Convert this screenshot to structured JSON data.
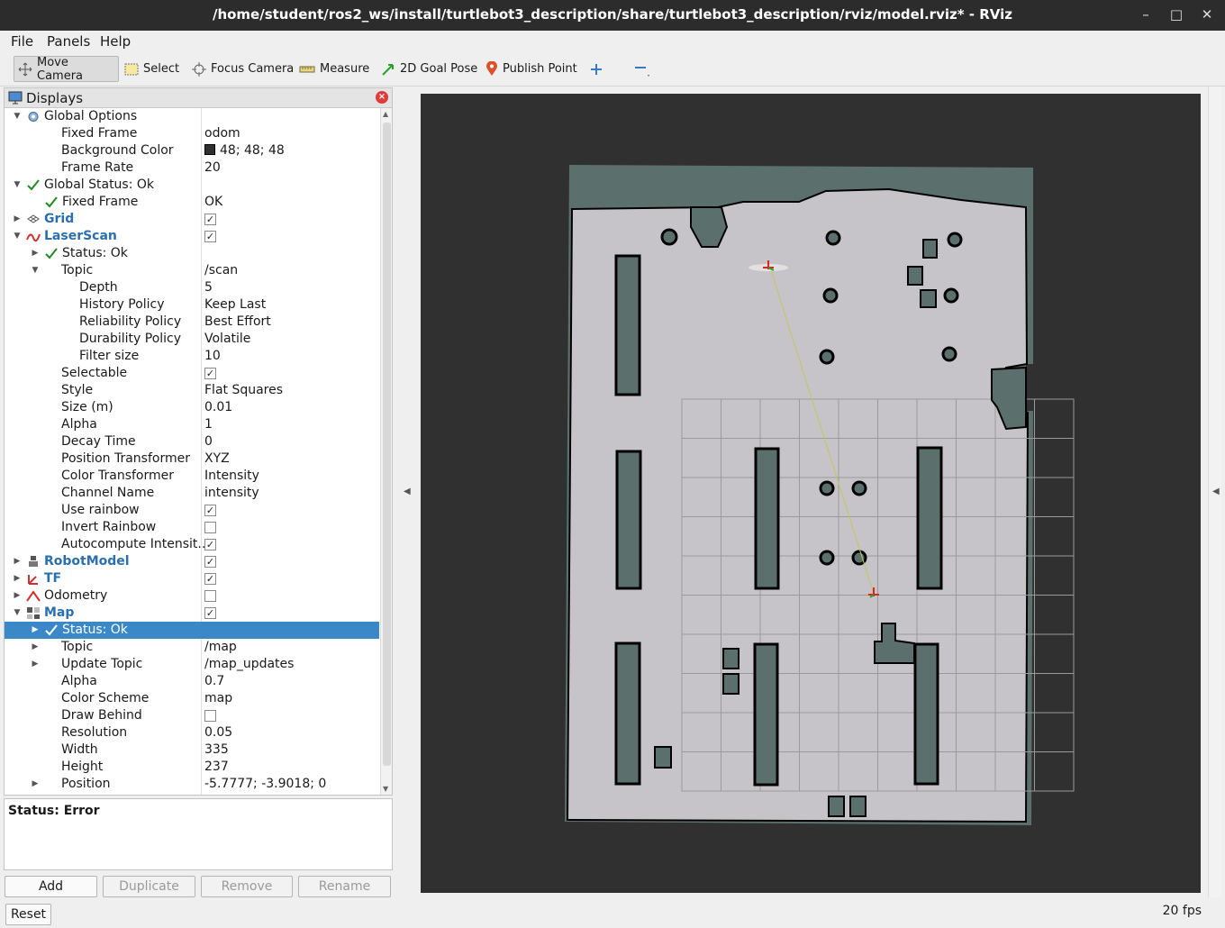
{
  "window": {
    "title": "/home/student/ros2_ws/install/turtlebot3_description/share/turtlebot3_description/rviz/model.rviz* - RViz"
  },
  "menu": [
    "File",
    "Panels",
    "Help"
  ],
  "toolbar": {
    "tools": [
      "Move Camera",
      "Select",
      "Focus Camera",
      "Measure",
      "2D Goal Pose",
      "Publish Point"
    ],
    "active": "Move Camera"
  },
  "displays": {
    "title": "Displays",
    "rows": [
      {
        "name": "Global Options",
        "value": "",
        "indent": 0,
        "expand": "open",
        "icon": "gear-icon"
      },
      {
        "name": "Fixed Frame",
        "value": "odom",
        "indent": 1
      },
      {
        "name": "Background Color",
        "value": "48; 48; 48",
        "indent": 1,
        "swatch": "#303030"
      },
      {
        "name": "Frame Rate",
        "value": "20",
        "indent": 1
      },
      {
        "name": "Global Status: Ok",
        "value": "",
        "indent": 0,
        "expand": "open",
        "icon": "check-icon"
      },
      {
        "name": "Fixed Frame",
        "value": "OK",
        "indent": 1,
        "icon": "check-icon"
      },
      {
        "name": "Grid",
        "value": "",
        "indent": 0,
        "expand": "closed",
        "icon": "grid-icon",
        "blue": true,
        "checked": true
      },
      {
        "name": "LaserScan",
        "value": "",
        "indent": 0,
        "expand": "open",
        "icon": "laserscan-icon",
        "blue": true,
        "checked": true
      },
      {
        "name": "Status: Ok",
        "value": "",
        "indent": 1,
        "expand": "closed",
        "icon": "check-icon"
      },
      {
        "name": "Topic",
        "value": "/scan",
        "indent": 1,
        "expand": "open"
      },
      {
        "name": "Depth",
        "value": "5",
        "indent": 2
      },
      {
        "name": "History Policy",
        "value": "Keep Last",
        "indent": 2
      },
      {
        "name": "Reliability Policy",
        "value": "Best Effort",
        "indent": 2
      },
      {
        "name": "Durability Policy",
        "value": "Volatile",
        "indent": 2
      },
      {
        "name": "Filter size",
        "value": "10",
        "indent": 2
      },
      {
        "name": "Selectable",
        "value": "",
        "indent": 1,
        "checked": true
      },
      {
        "name": "Style",
        "value": "Flat Squares",
        "indent": 1
      },
      {
        "name": "Size (m)",
        "value": "0.01",
        "indent": 1
      },
      {
        "name": "Alpha",
        "value": "1",
        "indent": 1
      },
      {
        "name": "Decay Time",
        "value": "0",
        "indent": 1
      },
      {
        "name": "Position Transformer",
        "value": "XYZ",
        "indent": 1
      },
      {
        "name": "Color Transformer",
        "value": "Intensity",
        "indent": 1
      },
      {
        "name": "Channel Name",
        "value": "intensity",
        "indent": 1
      },
      {
        "name": "Use rainbow",
        "value": "",
        "indent": 1,
        "checked": true
      },
      {
        "name": "Invert Rainbow",
        "value": "",
        "indent": 1,
        "checked": false
      },
      {
        "name": "Autocompute Intensit...",
        "value": "",
        "indent": 1,
        "checked": true
      },
      {
        "name": "RobotModel",
        "value": "",
        "indent": 0,
        "expand": "closed",
        "icon": "robot-icon",
        "blue": true,
        "checked": true
      },
      {
        "name": "TF",
        "value": "",
        "indent": 0,
        "expand": "closed",
        "icon": "tf-icon",
        "blue": true,
        "checked": true
      },
      {
        "name": "Odometry",
        "value": "",
        "indent": 0,
        "expand": "closed",
        "icon": "odometry-icon",
        "checked": false
      },
      {
        "name": "Map",
        "value": "",
        "indent": 0,
        "expand": "open",
        "icon": "map-icon",
        "blue": true,
        "checked": true
      },
      {
        "name": "Status: Ok",
        "value": "",
        "indent": 1,
        "expand": "closed",
        "icon": "check-icon",
        "selected": true
      },
      {
        "name": "Topic",
        "value": "/map",
        "indent": 1,
        "expand": "closed"
      },
      {
        "name": "Update Topic",
        "value": "/map_updates",
        "indent": 1,
        "expand": "closed"
      },
      {
        "name": "Alpha",
        "value": "0.7",
        "indent": 1
      },
      {
        "name": "Color Scheme",
        "value": "map",
        "indent": 1
      },
      {
        "name": "Draw Behind",
        "value": "",
        "indent": 1,
        "checked": false
      },
      {
        "name": "Resolution",
        "value": "0.05",
        "indent": 1
      },
      {
        "name": "Width",
        "value": "335",
        "indent": 1
      },
      {
        "name": "Height",
        "value": "237",
        "indent": 1
      },
      {
        "name": "Position",
        "value": "-5.7777; -3.9018; 0",
        "indent": 1,
        "expand": "closed"
      }
    ]
  },
  "status_pane": {
    "text": "Status: Error"
  },
  "buttons": {
    "add": "Add",
    "duplicate": "Duplicate",
    "remove": "Remove",
    "rename": "Rename",
    "reset": "Reset"
  },
  "fps": "20 fps"
}
